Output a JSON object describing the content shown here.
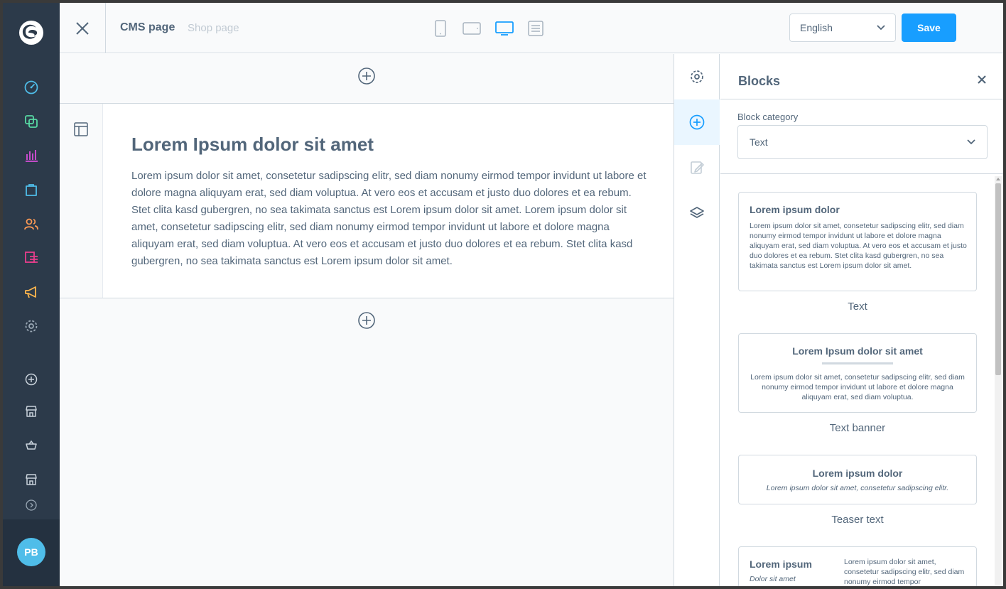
{
  "topbar": {
    "title": "CMS page",
    "subtitle": "Shop page",
    "language": "English",
    "save_label": "Save"
  },
  "sidebar": {
    "items": [
      {
        "icon": "dashboard-icon",
        "color": "#57d9a3"
      },
      {
        "icon": "catalogues-icon",
        "color": "#57d9a3"
      },
      {
        "icon": "reports-icon",
        "color": "#d84fdb"
      },
      {
        "icon": "orders-icon",
        "color": "#4fbde9"
      },
      {
        "icon": "customers-icon",
        "color": "#ff9a55"
      },
      {
        "icon": "content-icon",
        "color": "#e83e8c"
      },
      {
        "icon": "marketing-icon",
        "color": "#ffb74d"
      },
      {
        "icon": "settings-icon",
        "color": "#9aa8b5"
      }
    ],
    "avatar_initials": "PB"
  },
  "content": {
    "heading": "Lorem Ipsum dolor sit amet",
    "paragraph": "Lorem ipsum dolor sit amet, consetetur sadipscing elitr, sed diam nonumy eirmod tempor invidunt ut labore et dolore magna aliquyam erat, sed diam voluptua. At vero eos et accusam et justo duo dolores et ea rebum. Stet clita kasd gubergren, no sea takimata sanctus est Lorem ipsum dolor sit amet. Lorem ipsum dolor sit amet, consetetur sadipscing elitr, sed diam nonumy eirmod tempor invidunt ut labore et dolore magna aliquyam erat, sed diam voluptua. At vero eos et accusam et justo duo dolores et ea rebum. Stet clita kasd gubergren, no sea takimata sanctus est Lorem ipsum dolor sit amet."
  },
  "panel": {
    "title": "Blocks",
    "category_label": "Block category",
    "category_value": "Text",
    "blocks": [
      {
        "name": "Text",
        "heading": "Lorem ipsum dolor",
        "text": "Lorem ipsum dolor sit amet, consetetur sadipscing elitr, sed diam nonumy eirmod tempor invidunt ut labore et dolore magna aliquyam erat, sed diam voluptua. At vero eos et accusam et justo duo dolores et ea rebum. Stet clita kasd gubergren, no sea takimata sanctus est Lorem ipsum dolor sit amet."
      },
      {
        "name": "Text banner",
        "heading": "Lorem Ipsum dolor sit amet",
        "text": "Lorem ipsum dolor sit amet, consetetur sadipscing elitr, sed diam nonumy eirmod tempor invidunt ut labore et dolore magna aliquyam erat, sed diam voluptua."
      },
      {
        "name": "Teaser text",
        "heading": "Lorem ipsum dolor",
        "text": "Lorem ipsum dolor sit amet, consetetur sadipscing elitr."
      },
      {
        "heading": "Lorem ipsum",
        "subheading": "Dolor sit amet",
        "text": "Lorem ipsum dolor sit amet, consetetur sadipscing elitr, sed diam nonumy eirmod tempor"
      }
    ]
  },
  "colors": {
    "accent": "#189eff",
    "sidebar_bg": "#2c3a4a",
    "text": "#52667a",
    "avatar": "#4fbde9"
  }
}
